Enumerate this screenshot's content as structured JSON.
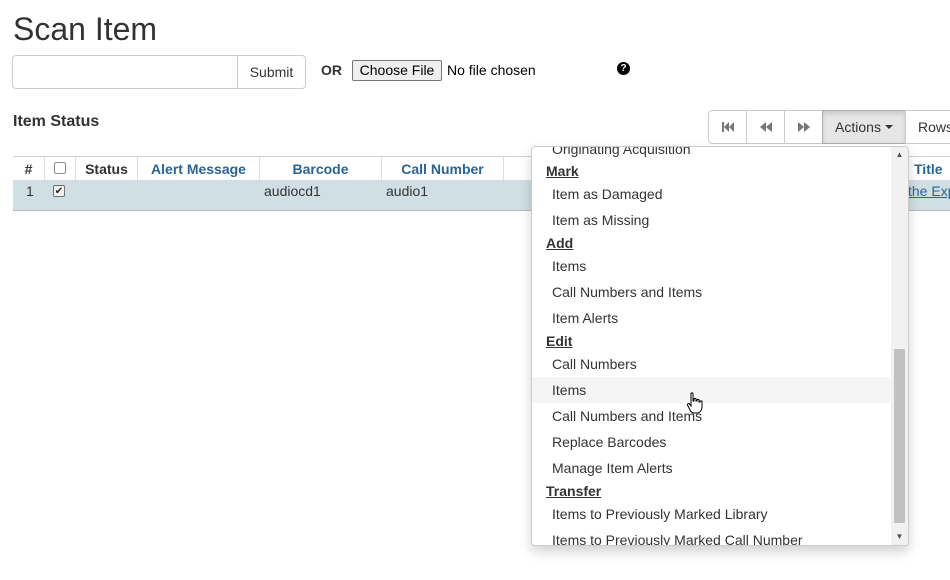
{
  "page": {
    "title": "Scan Item"
  },
  "scan_form": {
    "input_value": "",
    "submit_label": "Submit",
    "or_label": "OR",
    "choose_file_label": "Choose File",
    "file_status": "No file chosen",
    "help_icon": "question-circle-icon"
  },
  "item_status": {
    "title": "Item Status",
    "toolbar": {
      "first_icon": "first-page-icon",
      "prev_icon": "previous-page-icon",
      "next_icon": "next-page-icon",
      "actions_label": "Actions",
      "rows_label": "Rows"
    },
    "columns": [
      "#",
      "",
      "Status",
      "Alert Message",
      "Barcode",
      "Call Number",
      "Title"
    ],
    "rows": [
      {
        "index": "1",
        "checked": true,
        "status": "",
        "alert_message": "",
        "barcode": "audiocd1",
        "call_number": "audio1",
        "title": "the Exp"
      }
    ]
  },
  "actions_menu": {
    "partial_top_item": "Originating Acquisition",
    "groups": [
      {
        "header": "Mark",
        "items": [
          "Item as Damaged",
          "Item as Missing"
        ]
      },
      {
        "header": "Add",
        "items": [
          "Items",
          "Call Numbers and Items",
          "Item Alerts"
        ]
      },
      {
        "header": "Edit",
        "items": [
          "Call Numbers",
          "Items",
          "Call Numbers and Items",
          "Replace Barcodes",
          "Manage Item Alerts"
        ]
      },
      {
        "header": "Transfer",
        "items": [
          "Items to Previously Marked Library",
          "Items to Previously Marked Call Number"
        ]
      }
    ],
    "hovered_item": "Items"
  },
  "colors": {
    "link": "#2a6496",
    "selected_row": "#cfdfe3",
    "actions_active_bg": "#e6e6e6"
  }
}
